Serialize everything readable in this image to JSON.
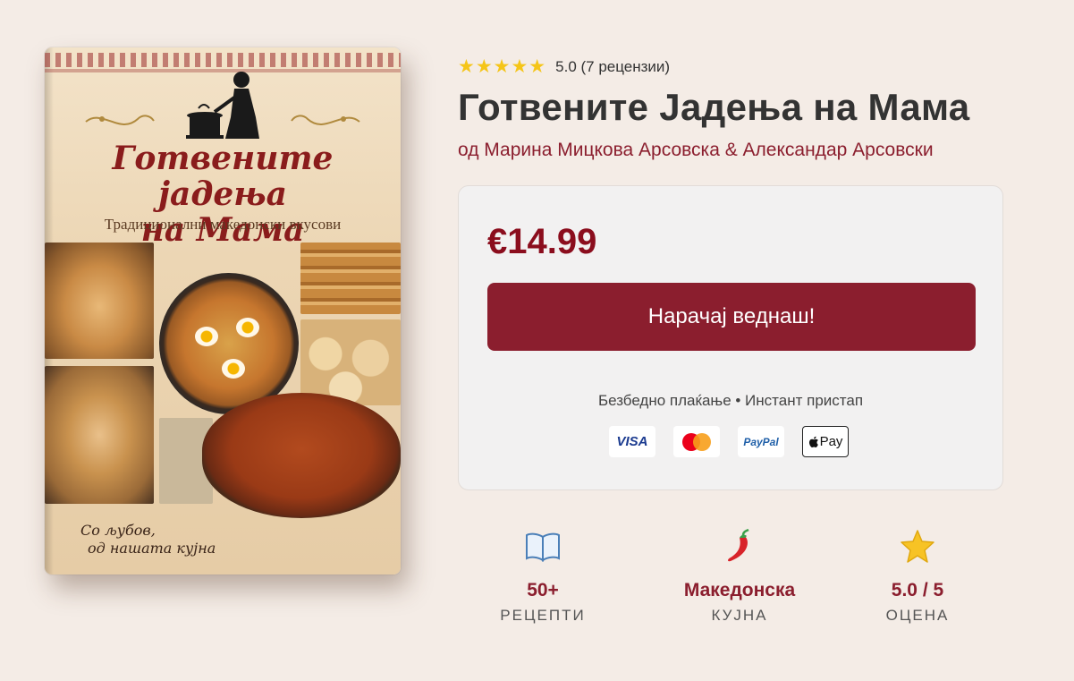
{
  "product": {
    "rating_stars": "★★★★★",
    "rating_text": "5.0 (7 рецензии)",
    "title": "Готвените Јадења на Мама",
    "author": "од Марина Мицкова Арсовска & Александар Арсовски"
  },
  "cover": {
    "title_line1": "Готвените јадења",
    "title_line2": "на Мама",
    "subtitle": "Традиционални македонски вкусови",
    "footer_line1": "Со љубов,",
    "footer_line2": "од нашата кујна"
  },
  "purchase": {
    "price": "€14.99",
    "button_label": "Нарачај веднаш!",
    "secure_text": "Безбедно плаќање • Инстант пристап",
    "payment_methods": [
      "VISA",
      "Mastercard",
      "PayPal",
      "Pay"
    ]
  },
  "stats": [
    {
      "icon": "book-icon",
      "value": "50+",
      "label": "РЕЦЕПТИ"
    },
    {
      "icon": "chili-pepper-icon",
      "value": "Македонска",
      "label": "КУЈНА"
    },
    {
      "icon": "star-icon",
      "value": "5.0 / 5",
      "label": "ОЦЕНА"
    }
  ],
  "colors": {
    "accent": "#8b1e2e",
    "price": "#8b0d1d",
    "star": "#f5c518",
    "background": "#f4ece6"
  }
}
